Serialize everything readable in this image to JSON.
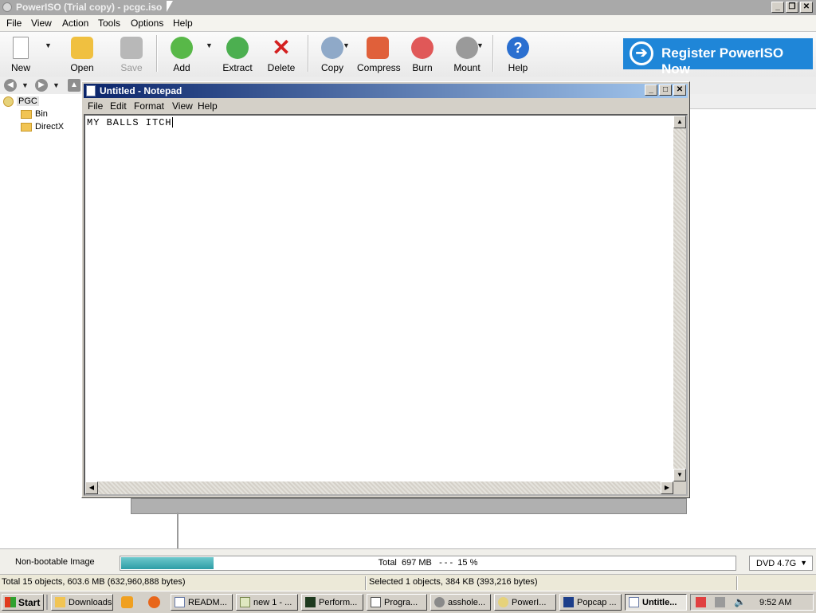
{
  "poweriso": {
    "title": "PowerISO (Trial copy) - pcgc.iso",
    "menu": [
      "File",
      "View",
      "Action",
      "Tools",
      "Options",
      "Help"
    ],
    "toolbar": {
      "new": "New",
      "open": "Open",
      "save": "Save",
      "add": "Add",
      "extract": "Extract",
      "delete": "Delete",
      "copy": "Copy",
      "compress": "Compress",
      "burn": "Burn",
      "mount": "Mount",
      "help": "Help"
    },
    "register": "Register PowerISO Now",
    "tree": {
      "root": "PGC",
      "children": [
        "Bin",
        "DirectX"
      ]
    },
    "status": {
      "image_type": "Non-bootable Image",
      "total": "Total  697 MB   - - -  15 %",
      "progress_fraction": 0.15,
      "media": "DVD 4.7G",
      "objects": "Total 15 objects, 603.6 MB (632,960,888 bytes)",
      "selected": "Selected 1 objects, 384 KB (393,216 bytes)"
    }
  },
  "notepad": {
    "title": "Untitled - Notepad",
    "menu": [
      "File",
      "Edit",
      "Format",
      "View",
      "Help"
    ],
    "content": "MY BALLS ITCH"
  },
  "taskbar": {
    "start": "Start",
    "tasks": [
      "Downloads",
      "READM...",
      "new 1 - ...",
      "Perform...",
      "Progra...",
      "asshole...",
      "PowerI...",
      "Popcap ...",
      "Untitle..."
    ],
    "clock": "9:52 AM"
  },
  "colors": {
    "register_bg": "#1f86d8",
    "progress_fill": "#2e9da6",
    "notepad_title_start": "#0a246a"
  }
}
